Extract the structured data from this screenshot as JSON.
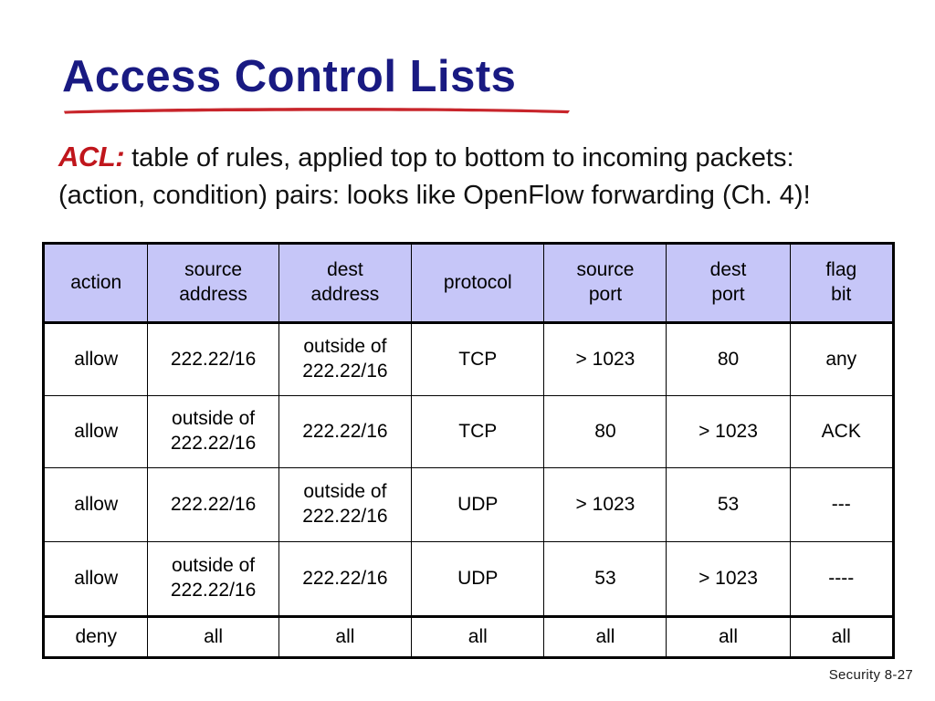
{
  "slide": {
    "title": "Access Control Lists",
    "title_color": "#191a82",
    "underline_color": "#c8252b",
    "subtitle_tag": "ACL:",
    "subtitle_tag_color": "#c0161c",
    "subtitle_line1": " table of rules, applied top to bottom to incoming packets:",
    "subtitle_line2": "(action, condition) pairs: looks like OpenFlow forwarding (Ch. 4)!",
    "footer": "Security  8-27"
  },
  "table": {
    "header_bg": "#c6c6f8",
    "headers": [
      {
        "line1": "action",
        "line2": ""
      },
      {
        "line1": "source",
        "line2": "address"
      },
      {
        "line1": "dest",
        "line2": "address"
      },
      {
        "line1": "protocol",
        "line2": ""
      },
      {
        "line1": "source",
        "line2": "port"
      },
      {
        "line1": "dest",
        "line2": "port"
      },
      {
        "line1": "flag",
        "line2": "bit"
      }
    ],
    "rows": [
      {
        "action": "allow",
        "source_address_l1": "222.22/16",
        "source_address_l2": "",
        "dest_address_l1": "outside of",
        "dest_address_l2": "222.22/16",
        "protocol": "TCP",
        "source_port": "> 1023",
        "dest_port": "80",
        "flag_bit": "any"
      },
      {
        "action": "allow",
        "source_address_l1": "outside of",
        "source_address_l2": "222.22/16",
        "dest_address_l1": "222.22/16",
        "dest_address_l2": "",
        "protocol": "TCP",
        "source_port": "80",
        "dest_port": "> 1023",
        "flag_bit": "ACK"
      },
      {
        "action": "allow",
        "source_address_l1": "222.22/16",
        "source_address_l2": "",
        "dest_address_l1": "outside of",
        "dest_address_l2": "222.22/16",
        "protocol": "UDP",
        "source_port": "> 1023",
        "dest_port": "53",
        "flag_bit": "---"
      },
      {
        "action": "allow",
        "source_address_l1": "outside of",
        "source_address_l2": "222.22/16",
        "dest_address_l1": "222.22/16",
        "dest_address_l2": "",
        "protocol": "UDP",
        "source_port": "53",
        "dest_port": "> 1023",
        "flag_bit": "----"
      },
      {
        "action": "deny",
        "source_address_l1": "all",
        "source_address_l2": "",
        "dest_address_l1": "all",
        "dest_address_l2": "",
        "protocol": "all",
        "source_port": "all",
        "dest_port": "all",
        "flag_bit": "all"
      }
    ]
  }
}
